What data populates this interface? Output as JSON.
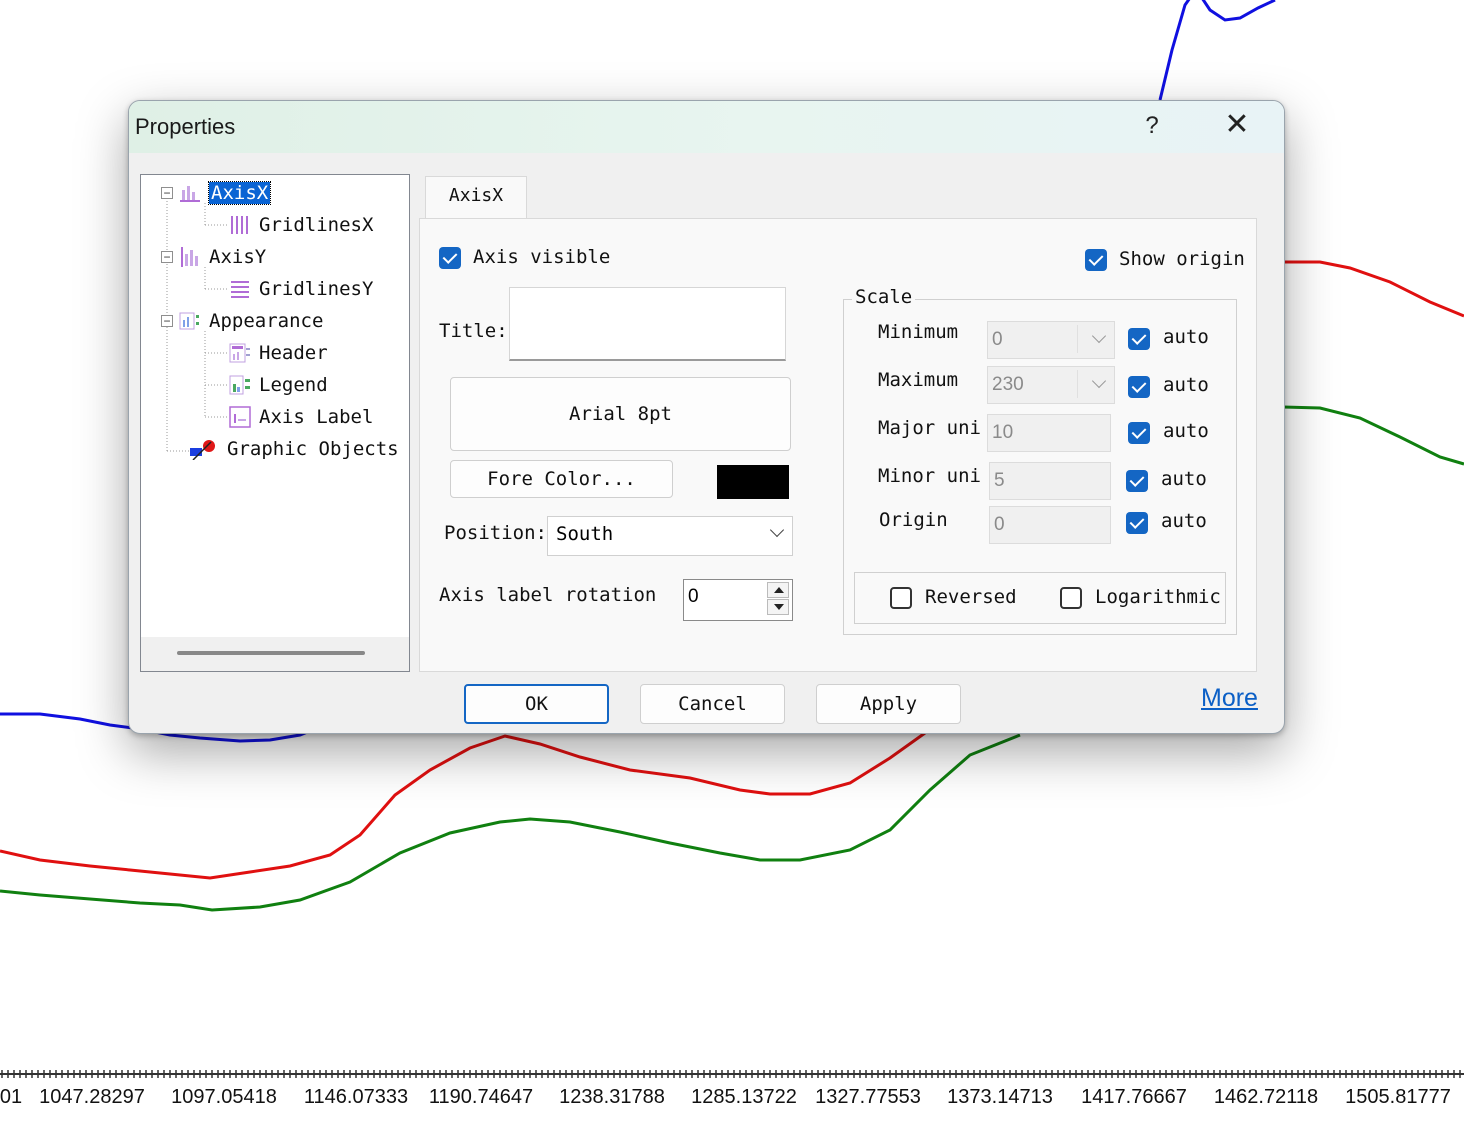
{
  "chart_data": {
    "type": "line",
    "x_tick_labels": [
      "01",
      "1047.28297",
      "1097.05418",
      "1146.07333",
      "1190.74647",
      "1238.31788",
      "1285.13722",
      "1327.77553",
      "1373.14713",
      "1417.76667",
      "1462.72118",
      "1505.81777"
    ],
    "series": [
      {
        "color": "#1010e0"
      },
      {
        "color": "#e01010"
      },
      {
        "color": "#108010"
      }
    ],
    "grid": false
  },
  "dialog": {
    "title": "Properties",
    "help_glyph": "?",
    "close_glyph": "✕",
    "tree": {
      "items": [
        {
          "label": "AxisX",
          "selected": true,
          "icon": "axis-x-icon"
        },
        {
          "label": "GridlinesX",
          "icon": "gridlines-x-icon"
        },
        {
          "label": "AxisY",
          "icon": "axis-y-icon"
        },
        {
          "label": "GridlinesY",
          "icon": "gridlines-y-icon"
        },
        {
          "label": "Appearance",
          "icon": "appearance-icon"
        },
        {
          "label": "Header",
          "icon": "header-icon"
        },
        {
          "label": "Legend",
          "icon": "legend-icon"
        },
        {
          "label": "Axis Label",
          "icon": "axis-label-icon"
        },
        {
          "label": "Graphic Objects",
          "icon": "graphic-objects-icon"
        }
      ]
    },
    "tab": "AxisX",
    "axis_visible": {
      "label": "Axis visible",
      "checked": true
    },
    "show_origin": {
      "label": "Show origin",
      "checked": true
    },
    "title_label": "Title:",
    "title_value": "",
    "font_button": "Arial 8pt",
    "fore_color_button": "Fore Color...",
    "fore_color": "#000000",
    "position_label": "Position:",
    "position_value": "South",
    "rotation_label": "Axis label rotation",
    "rotation_value": "0",
    "scale": {
      "caption": "Scale",
      "rows": [
        {
          "label": "Minimum",
          "value": "0",
          "auto": "auto",
          "has_dropdown": true
        },
        {
          "label": "Maximum",
          "value": "230",
          "auto": "auto",
          "has_dropdown": true
        },
        {
          "label": "Major uni",
          "value": "10",
          "auto": "auto"
        },
        {
          "label": "Minor uni",
          "value": "5",
          "auto": "auto"
        },
        {
          "label": "Origin",
          "value": "0",
          "auto": "auto"
        }
      ],
      "reversed": {
        "label": "Reversed",
        "checked": false
      },
      "logarithmic": {
        "label": "Logarithmic",
        "checked": false
      }
    },
    "buttons": {
      "ok": "OK",
      "cancel": "Cancel",
      "apply": "Apply"
    },
    "more_link": "More"
  }
}
